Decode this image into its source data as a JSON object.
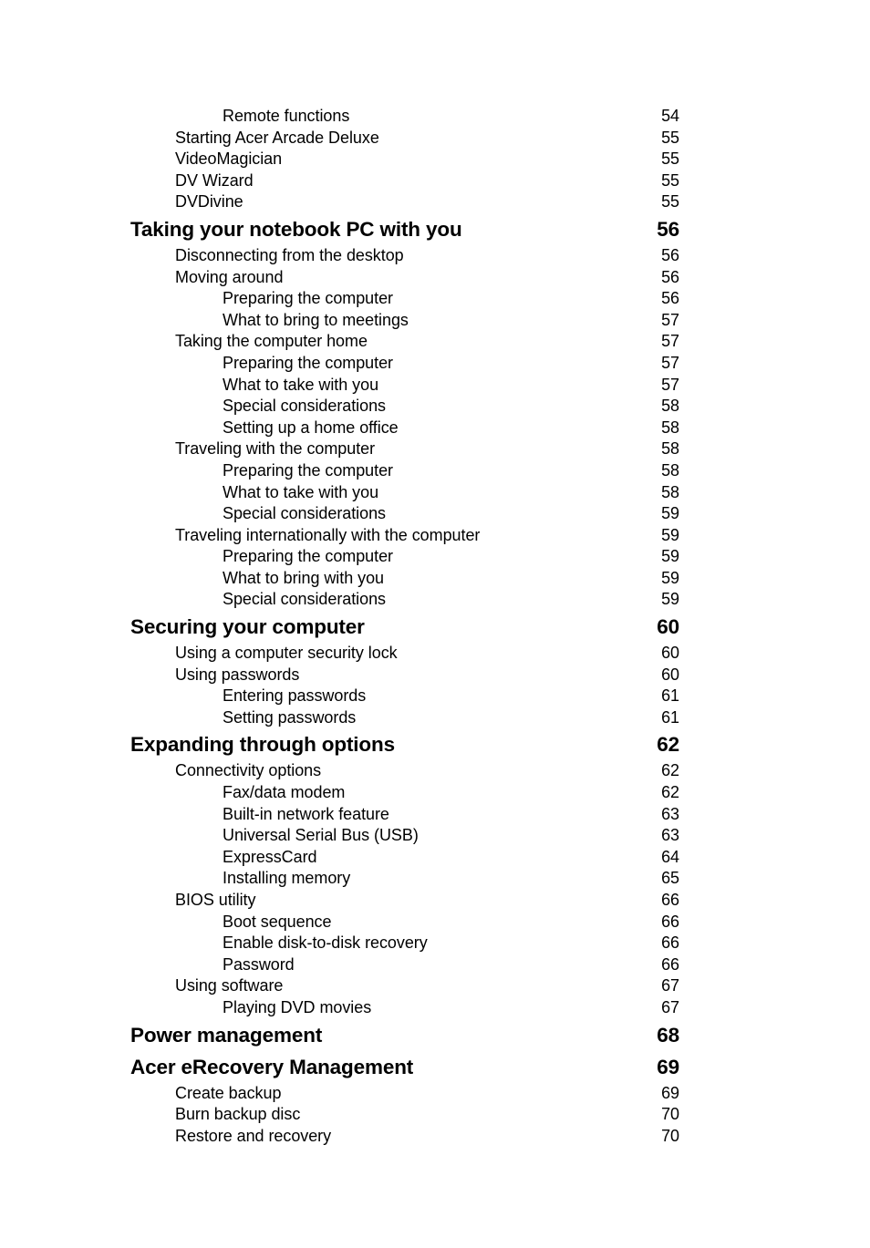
{
  "document": {
    "type": "table-of-contents",
    "background_color": "#ffffff",
    "text_color": "#000000"
  },
  "toc": {
    "entries": [
      {
        "level": 3,
        "title": "Remote functions",
        "page": "54"
      },
      {
        "level": 2,
        "title": "Starting Acer Arcade Deluxe",
        "page": "55"
      },
      {
        "level": 2,
        "title": "VideoMagician",
        "page": "55"
      },
      {
        "level": 2,
        "title": "DV Wizard",
        "page": "55"
      },
      {
        "level": 2,
        "title": "DVDivine",
        "page": "55"
      },
      {
        "level": 1,
        "title": "Taking your notebook PC with you",
        "page": "56"
      },
      {
        "level": 2,
        "title": "Disconnecting from the desktop",
        "page": "56"
      },
      {
        "level": 2,
        "title": "Moving around",
        "page": "56"
      },
      {
        "level": 3,
        "title": "Preparing the computer",
        "page": "56"
      },
      {
        "level": 3,
        "title": "What to bring to meetings",
        "page": "57"
      },
      {
        "level": 2,
        "title": "Taking the computer home",
        "page": "57"
      },
      {
        "level": 3,
        "title": "Preparing the computer",
        "page": "57"
      },
      {
        "level": 3,
        "title": "What to take with you",
        "page": "57"
      },
      {
        "level": 3,
        "title": "Special considerations",
        "page": "58"
      },
      {
        "level": 3,
        "title": "Setting up a home office",
        "page": "58"
      },
      {
        "level": 2,
        "title": "Traveling with the computer",
        "page": "58"
      },
      {
        "level": 3,
        "title": "Preparing the computer",
        "page": "58"
      },
      {
        "level": 3,
        "title": "What to take with you",
        "page": "58"
      },
      {
        "level": 3,
        "title": "Special considerations",
        "page": "59"
      },
      {
        "level": 2,
        "title": "Traveling internationally with the computer",
        "page": "59"
      },
      {
        "level": 3,
        "title": "Preparing the computer",
        "page": "59"
      },
      {
        "level": 3,
        "title": "What to bring with you",
        "page": "59"
      },
      {
        "level": 3,
        "title": "Special considerations",
        "page": "59"
      },
      {
        "level": 1,
        "title": "Securing your computer",
        "page": "60"
      },
      {
        "level": 2,
        "title": "Using a computer security lock",
        "page": "60"
      },
      {
        "level": 2,
        "title": "Using passwords",
        "page": "60"
      },
      {
        "level": 3,
        "title": "Entering passwords",
        "page": "61"
      },
      {
        "level": 3,
        "title": "Setting passwords",
        "page": "61"
      },
      {
        "level": 1,
        "title": "Expanding through options",
        "page": "62"
      },
      {
        "level": 2,
        "title": "Connectivity options",
        "page": "62"
      },
      {
        "level": 3,
        "title": "Fax/data modem",
        "page": "62"
      },
      {
        "level": 3,
        "title": "Built-in network feature",
        "page": "63"
      },
      {
        "level": 3,
        "title": "Universal Serial Bus (USB)",
        "page": "63"
      },
      {
        "level": 3,
        "title": "ExpressCard",
        "page": "64"
      },
      {
        "level": 3,
        "title": "Installing memory",
        "page": "65"
      },
      {
        "level": 2,
        "title": "BIOS utility",
        "page": "66"
      },
      {
        "level": 3,
        "title": "Boot sequence",
        "page": "66"
      },
      {
        "level": 3,
        "title": "Enable disk-to-disk recovery",
        "page": "66"
      },
      {
        "level": 3,
        "title": "Password",
        "page": "66"
      },
      {
        "level": 2,
        "title": "Using software",
        "page": "67"
      },
      {
        "level": 3,
        "title": "Playing DVD movies",
        "page": "67"
      },
      {
        "level": 1,
        "title": "Power management",
        "page": "68"
      },
      {
        "level": 1,
        "title": "Acer eRecovery Management",
        "page": "69"
      },
      {
        "level": 2,
        "title": "Create backup",
        "page": "69"
      },
      {
        "level": 2,
        "title": "Burn backup disc",
        "page": "70"
      },
      {
        "level": 2,
        "title": "Restore and recovery",
        "page": "70"
      }
    ]
  }
}
